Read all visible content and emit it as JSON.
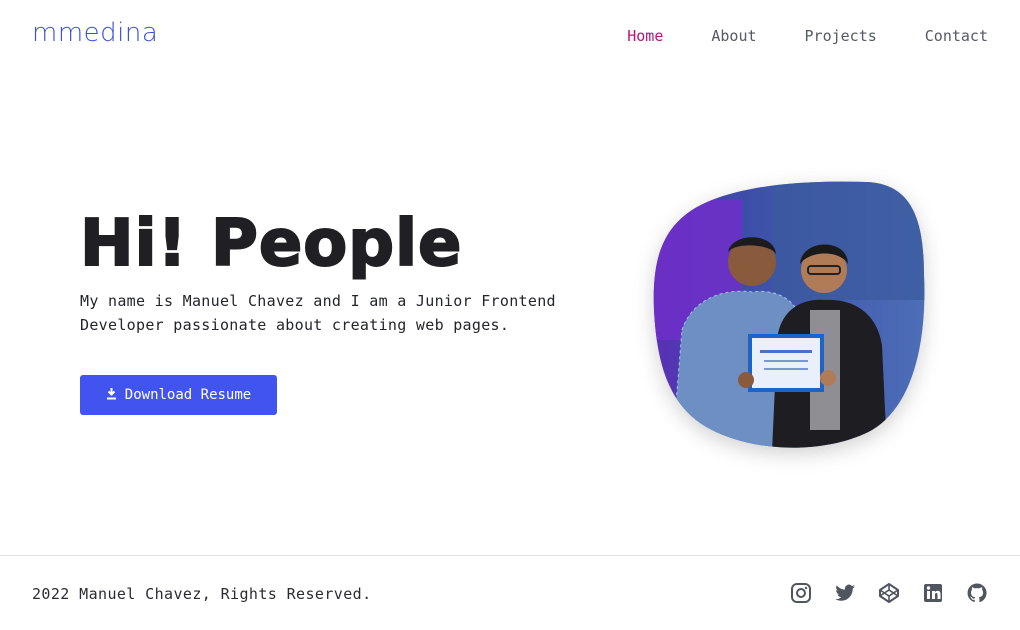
{
  "brand": {
    "logo": "mmedina"
  },
  "nav": {
    "items": [
      {
        "label": "Home",
        "active": true
      },
      {
        "label": "About",
        "active": false
      },
      {
        "label": "Projects",
        "active": false
      },
      {
        "label": "Contact",
        "active": false
      }
    ]
  },
  "hero": {
    "title": "Hi! People",
    "description": "My name is Manuel Chavez and I am a Junior Frontend Developer passionate about creating web pages.",
    "download_label": "Download Resume",
    "download_icon": "download-icon"
  },
  "footer": {
    "copyright": "2022 Manuel Chavez, Rights Reserved.",
    "social_icons": [
      "instagram-icon",
      "twitter-icon",
      "codepen-icon",
      "linkedin-icon",
      "github-icon"
    ]
  },
  "colors": {
    "accent": "#4254f0",
    "logo": "#3b4fe0",
    "nav_active": "#c0107c"
  }
}
